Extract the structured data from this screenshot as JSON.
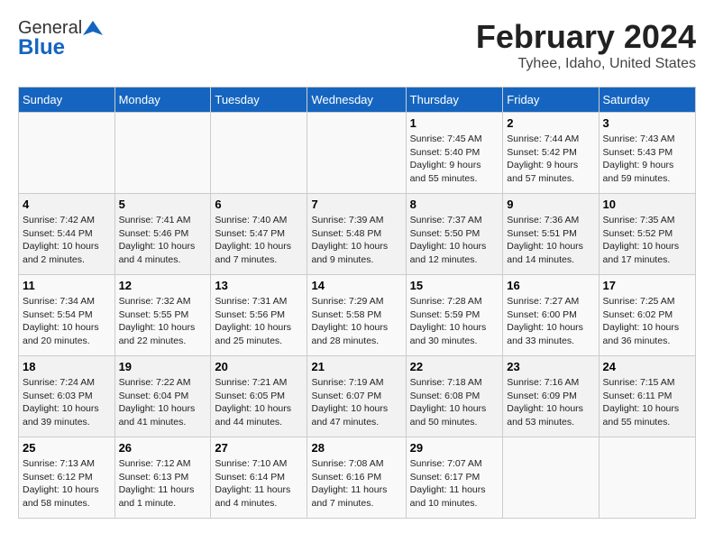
{
  "header": {
    "logo_general": "General",
    "logo_blue": "Blue",
    "month_year": "February 2024",
    "location": "Tyhee, Idaho, United States"
  },
  "weekdays": [
    "Sunday",
    "Monday",
    "Tuesday",
    "Wednesday",
    "Thursday",
    "Friday",
    "Saturday"
  ],
  "weeks": [
    [
      {
        "day": "",
        "sunrise": "",
        "sunset": "",
        "daylight": ""
      },
      {
        "day": "",
        "sunrise": "",
        "sunset": "",
        "daylight": ""
      },
      {
        "day": "",
        "sunrise": "",
        "sunset": "",
        "daylight": ""
      },
      {
        "day": "",
        "sunrise": "",
        "sunset": "",
        "daylight": ""
      },
      {
        "day": "1",
        "sunrise": "Sunrise: 7:45 AM",
        "sunset": "Sunset: 5:40 PM",
        "daylight": "Daylight: 9 hours and 55 minutes."
      },
      {
        "day": "2",
        "sunrise": "Sunrise: 7:44 AM",
        "sunset": "Sunset: 5:42 PM",
        "daylight": "Daylight: 9 hours and 57 minutes."
      },
      {
        "day": "3",
        "sunrise": "Sunrise: 7:43 AM",
        "sunset": "Sunset: 5:43 PM",
        "daylight": "Daylight: 9 hours and 59 minutes."
      }
    ],
    [
      {
        "day": "4",
        "sunrise": "Sunrise: 7:42 AM",
        "sunset": "Sunset: 5:44 PM",
        "daylight": "Daylight: 10 hours and 2 minutes."
      },
      {
        "day": "5",
        "sunrise": "Sunrise: 7:41 AM",
        "sunset": "Sunset: 5:46 PM",
        "daylight": "Daylight: 10 hours and 4 minutes."
      },
      {
        "day": "6",
        "sunrise": "Sunrise: 7:40 AM",
        "sunset": "Sunset: 5:47 PM",
        "daylight": "Daylight: 10 hours and 7 minutes."
      },
      {
        "day": "7",
        "sunrise": "Sunrise: 7:39 AM",
        "sunset": "Sunset: 5:48 PM",
        "daylight": "Daylight: 10 hours and 9 minutes."
      },
      {
        "day": "8",
        "sunrise": "Sunrise: 7:37 AM",
        "sunset": "Sunset: 5:50 PM",
        "daylight": "Daylight: 10 hours and 12 minutes."
      },
      {
        "day": "9",
        "sunrise": "Sunrise: 7:36 AM",
        "sunset": "Sunset: 5:51 PM",
        "daylight": "Daylight: 10 hours and 14 minutes."
      },
      {
        "day": "10",
        "sunrise": "Sunrise: 7:35 AM",
        "sunset": "Sunset: 5:52 PM",
        "daylight": "Daylight: 10 hours and 17 minutes."
      }
    ],
    [
      {
        "day": "11",
        "sunrise": "Sunrise: 7:34 AM",
        "sunset": "Sunset: 5:54 PM",
        "daylight": "Daylight: 10 hours and 20 minutes."
      },
      {
        "day": "12",
        "sunrise": "Sunrise: 7:32 AM",
        "sunset": "Sunset: 5:55 PM",
        "daylight": "Daylight: 10 hours and 22 minutes."
      },
      {
        "day": "13",
        "sunrise": "Sunrise: 7:31 AM",
        "sunset": "Sunset: 5:56 PM",
        "daylight": "Daylight: 10 hours and 25 minutes."
      },
      {
        "day": "14",
        "sunrise": "Sunrise: 7:29 AM",
        "sunset": "Sunset: 5:58 PM",
        "daylight": "Daylight: 10 hours and 28 minutes."
      },
      {
        "day": "15",
        "sunrise": "Sunrise: 7:28 AM",
        "sunset": "Sunset: 5:59 PM",
        "daylight": "Daylight: 10 hours and 30 minutes."
      },
      {
        "day": "16",
        "sunrise": "Sunrise: 7:27 AM",
        "sunset": "Sunset: 6:00 PM",
        "daylight": "Daylight: 10 hours and 33 minutes."
      },
      {
        "day": "17",
        "sunrise": "Sunrise: 7:25 AM",
        "sunset": "Sunset: 6:02 PM",
        "daylight": "Daylight: 10 hours and 36 minutes."
      }
    ],
    [
      {
        "day": "18",
        "sunrise": "Sunrise: 7:24 AM",
        "sunset": "Sunset: 6:03 PM",
        "daylight": "Daylight: 10 hours and 39 minutes."
      },
      {
        "day": "19",
        "sunrise": "Sunrise: 7:22 AM",
        "sunset": "Sunset: 6:04 PM",
        "daylight": "Daylight: 10 hours and 41 minutes."
      },
      {
        "day": "20",
        "sunrise": "Sunrise: 7:21 AM",
        "sunset": "Sunset: 6:05 PM",
        "daylight": "Daylight: 10 hours and 44 minutes."
      },
      {
        "day": "21",
        "sunrise": "Sunrise: 7:19 AM",
        "sunset": "Sunset: 6:07 PM",
        "daylight": "Daylight: 10 hours and 47 minutes."
      },
      {
        "day": "22",
        "sunrise": "Sunrise: 7:18 AM",
        "sunset": "Sunset: 6:08 PM",
        "daylight": "Daylight: 10 hours and 50 minutes."
      },
      {
        "day": "23",
        "sunrise": "Sunrise: 7:16 AM",
        "sunset": "Sunset: 6:09 PM",
        "daylight": "Daylight: 10 hours and 53 minutes."
      },
      {
        "day": "24",
        "sunrise": "Sunrise: 7:15 AM",
        "sunset": "Sunset: 6:11 PM",
        "daylight": "Daylight: 10 hours and 55 minutes."
      }
    ],
    [
      {
        "day": "25",
        "sunrise": "Sunrise: 7:13 AM",
        "sunset": "Sunset: 6:12 PM",
        "daylight": "Daylight: 10 hours and 58 minutes."
      },
      {
        "day": "26",
        "sunrise": "Sunrise: 7:12 AM",
        "sunset": "Sunset: 6:13 PM",
        "daylight": "Daylight: 11 hours and 1 minute."
      },
      {
        "day": "27",
        "sunrise": "Sunrise: 7:10 AM",
        "sunset": "Sunset: 6:14 PM",
        "daylight": "Daylight: 11 hours and 4 minutes."
      },
      {
        "day": "28",
        "sunrise": "Sunrise: 7:08 AM",
        "sunset": "Sunset: 6:16 PM",
        "daylight": "Daylight: 11 hours and 7 minutes."
      },
      {
        "day": "29",
        "sunrise": "Sunrise: 7:07 AM",
        "sunset": "Sunset: 6:17 PM",
        "daylight": "Daylight: 11 hours and 10 minutes."
      },
      {
        "day": "",
        "sunrise": "",
        "sunset": "",
        "daylight": ""
      },
      {
        "day": "",
        "sunrise": "",
        "sunset": "",
        "daylight": ""
      }
    ]
  ]
}
